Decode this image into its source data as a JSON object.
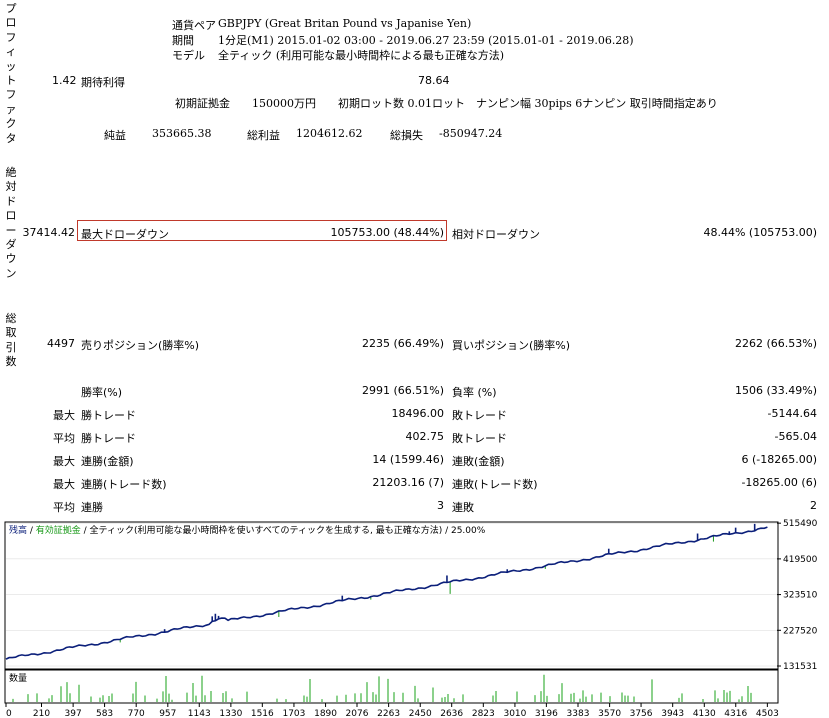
{
  "side_labels": {
    "profit_factor": "プロフィットファクタ",
    "abs_drawdown": "絶対ドローダウン",
    "total_trades": "総取引数"
  },
  "header": {
    "pair_label": "通貨ペア",
    "pair_value": "GBPJPY (Great Britan Pound vs Japanise Yen)",
    "period_label": "期間",
    "period_value": "1分足(M1) 2015.01-02 03:00 - 2019.06.27 23:59 (2015.01-01 - 2019.06.28)",
    "model_label": "モデル",
    "model_value": "全ティック (利用可能な最小時間枠による最も正確な方法)"
  },
  "summary": {
    "profit_factor": "1.42",
    "expected_payoff_label": "期待利得",
    "expected_payoff": "78.64",
    "settings": "初期証拠金　　150000万円　　初期ロット数  0.01ロット　ナンピン幅  30pips  6ナンピン  取引時間指定あり",
    "net_label": "純益",
    "net_value": "353665.38",
    "gross_profit_label": "総利益",
    "gross_profit_value": "1204612.62",
    "gross_loss_label": "総損失",
    "gross_loss_value": "-850947.24"
  },
  "drawdown": {
    "abs_value": "37414.42",
    "max_label": "最大ドローダウン",
    "max_value": "105753.00 (48.44%)",
    "rel_label": "相対ドローダウン",
    "rel_value": "48.44% (105753.00)"
  },
  "trades": {
    "total": "4497",
    "short_label": "売りポジション(勝率%)",
    "short_value": "2235 (66.49%)",
    "long_label": "買いポジション(勝率%)",
    "long_value": "2262 (66.53%)",
    "win_label": "勝率(%)",
    "win_value": "2991 (66.51%)",
    "loss_label": "負率 (%)",
    "loss_value": "1506 (33.49%)",
    "rows": [
      {
        "prefix": "最大",
        "left_label": "勝トレード",
        "left_value": "18496.00",
        "right_label": "敗トレード",
        "right_value": "-5144.64"
      },
      {
        "prefix": "平均",
        "left_label": "勝トレード",
        "left_value": "402.75",
        "right_label": "敗トレード",
        "right_value": "-565.04"
      },
      {
        "prefix": "最大",
        "left_label": "連勝(金額)",
        "left_value": "14 (1599.46)",
        "right_label": "連敗(金額)",
        "right_value": "6 (-18265.00)"
      },
      {
        "prefix": "最大",
        "left_label": "連勝(トレード数)",
        "left_value": "21203.16 (7)",
        "right_label": "連敗(トレード数)",
        "right_value": "-18265.00 (6)"
      },
      {
        "prefix": "平均",
        "left_label": "連勝",
        "left_value": "3",
        "right_label": "連敗",
        "right_value": "2"
      }
    ]
  },
  "chart": {
    "legend_balance": "残高",
    "legend_sep1": " / ",
    "legend_equity": "有効証拠金",
    "legend_rest": " / 全ティック(利用可能な最小時間枠を使いすべてのティックを生成する, 最も正確な方法) / 25.00%",
    "volume_label": "数量",
    "colors": {
      "balance": "#0b1f7a",
      "equity": "#1a9a1a",
      "volume": "#1aa31a"
    }
  },
  "chart_data": {
    "type": "line",
    "series": [
      {
        "name": "残高",
        "color": "#0b1f7a"
      }
    ],
    "y_ticks": [
      515490,
      419500,
      323510,
      227520,
      131531
    ],
    "ylim": [
      131531,
      515490
    ],
    "x_ticks": [
      0,
      210,
      397,
      583,
      770,
      957,
      1143,
      1330,
      1516,
      1703,
      1890,
      2076,
      2263,
      2450,
      2636,
      2823,
      3010,
      3196,
      3383,
      3570,
      3756,
      3943,
      4130,
      4316,
      4503
    ],
    "xlim": [
      0,
      4560
    ],
    "balance_start": 150000,
    "balance_end": 503665,
    "volume_label": "数量"
  }
}
